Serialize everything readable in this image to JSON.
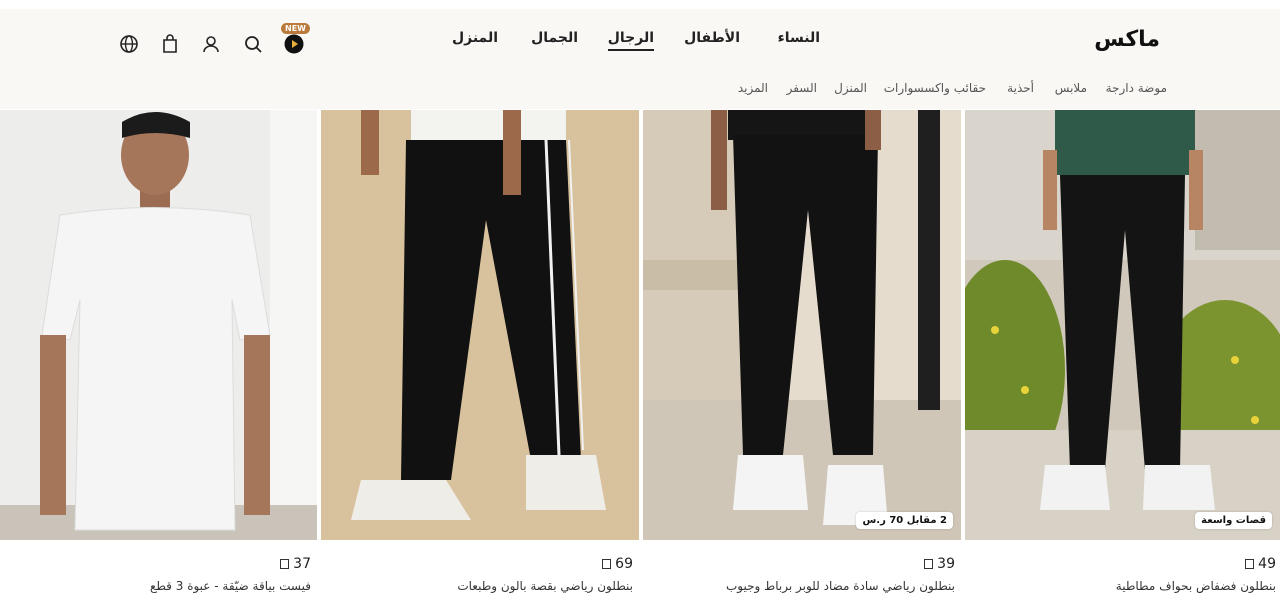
{
  "brand": {
    "logo_text": "ماكس"
  },
  "main_nav": [
    {
      "label": "النساء"
    },
    {
      "label": "الأطفال"
    },
    {
      "label": "الرجال",
      "active": true
    },
    {
      "label": "الجمال"
    },
    {
      "label": "المنزل"
    }
  ],
  "header_icons": {
    "badge_new": "NEW"
  },
  "sub_nav": [
    {
      "label": "موضة دارجة"
    },
    {
      "label": "ملابس"
    },
    {
      "label": "أحذية"
    },
    {
      "label": "حقائب واكسسوارات"
    },
    {
      "label": "المنزل"
    },
    {
      "label": "السفر"
    },
    {
      "label": "المزيد"
    }
  ],
  "products": [
    {
      "price": "37",
      "title": "فيست بياقة ضيّقة - عبوة 3 قطع",
      "tag": ""
    },
    {
      "price": "69",
      "title": "بنطلون رياضي بقصة بالون وطبعات",
      "tag": ""
    },
    {
      "price": "39",
      "title": "بنطلون رياضي سادة مضاد للوبر برباط وجيوب",
      "tag": "2 مقابل 70 ر.س"
    },
    {
      "price": "49",
      "title": "بنطلون فضفاض بحواف مطاطية",
      "tag": "قصات واسعة"
    }
  ],
  "colors": {
    "header_bg": "#faf8f5",
    "badge_bg": "#b97a3c",
    "text": "#222222"
  }
}
